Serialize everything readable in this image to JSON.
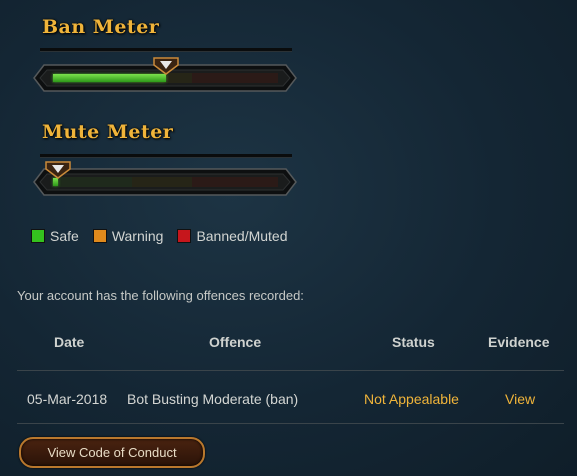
{
  "ban_meter": {
    "title": "Ban Meter",
    "level": 0.5
  },
  "mute_meter": {
    "title": "Mute Meter",
    "level": 0.02
  },
  "legend": [
    {
      "label": "Safe",
      "color": "#34c21e"
    },
    {
      "label": "Warning",
      "color": "#e08a1c"
    },
    {
      "label": "Banned/Muted",
      "color": "#c6161c"
    }
  ],
  "info_text": "Your account has the following offences recorded:",
  "table": {
    "headers": {
      "date": "Date",
      "offence": "Offence",
      "status": "Status",
      "evidence": "Evidence"
    },
    "rows": [
      {
        "date": "05-Mar-2018",
        "offence": "Bot Busting Moderate (ban)",
        "status": "Not Appealable",
        "evidence": "View"
      }
    ]
  },
  "coc_button": "View Code of Conduct"
}
